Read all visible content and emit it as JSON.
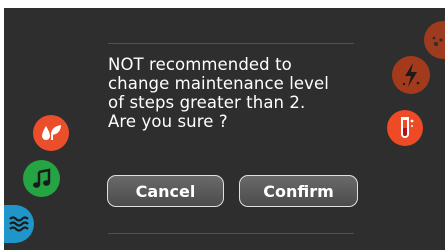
{
  "dialog": {
    "message_lines": [
      "NOT recommended to",
      "change maintenance level",
      "of steps greater than 2.",
      "Are you sure ?"
    ],
    "cancel_label": "Cancel",
    "confirm_label": "Confirm"
  },
  "icons": {
    "left": [
      "water-drop-leaf-icon",
      "music-note-icon",
      "waves-icon"
    ],
    "right": [
      "speckle-icon",
      "lightning-icon",
      "test-tube-icon"
    ]
  },
  "colors": {
    "background": "#2e2e2e",
    "accent_rule": "#b5252a",
    "button_fill": "#5a5a5a",
    "orange": "#ea4e2b",
    "green": "#25a443",
    "blue": "#1f95c9"
  }
}
